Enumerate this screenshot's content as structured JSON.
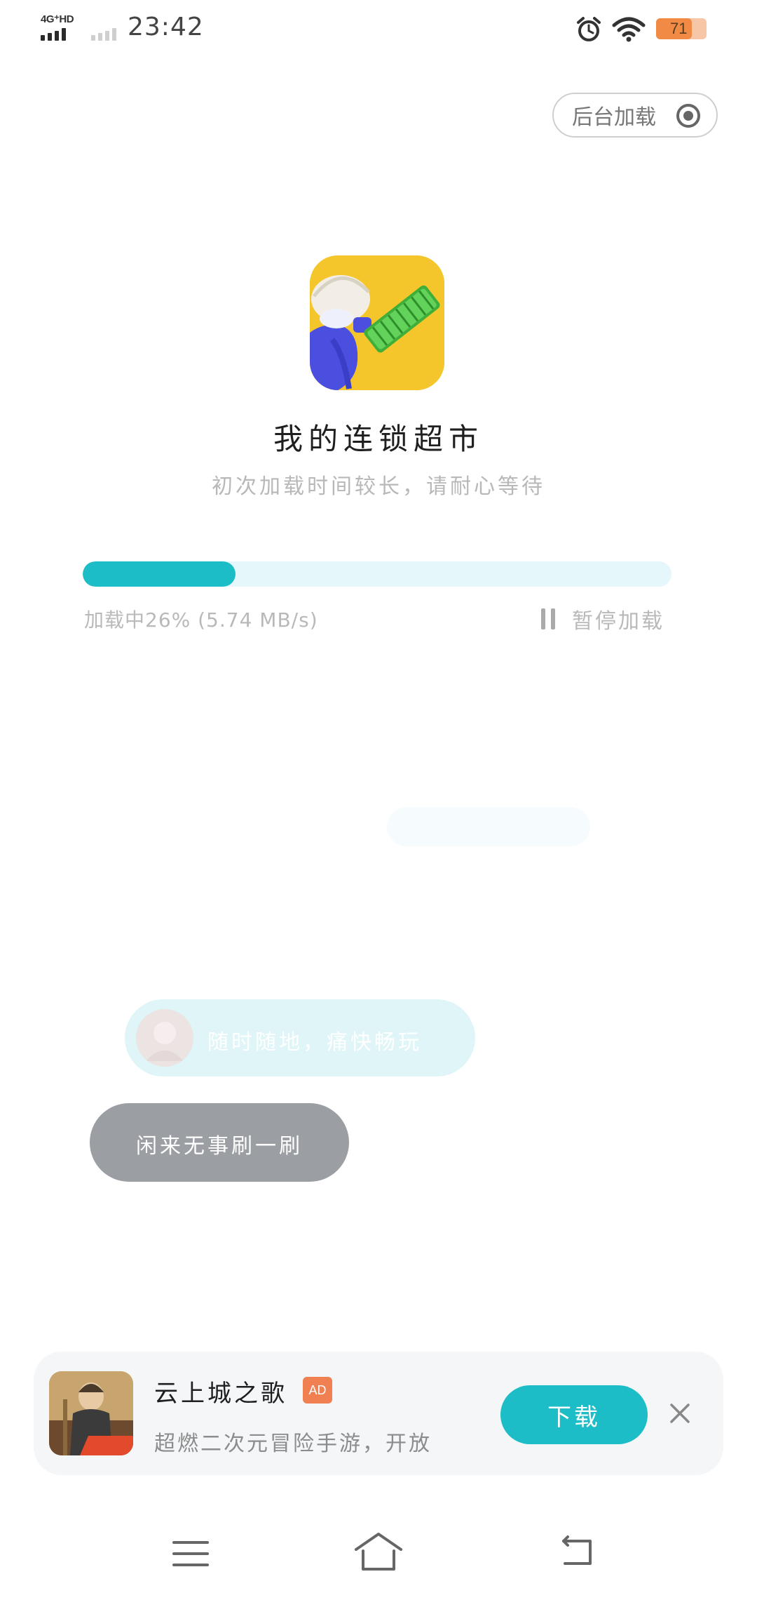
{
  "status_bar": {
    "network_label": "4G⁺HD",
    "time": "23:42",
    "battery_level": "71",
    "icons": [
      "alarm-icon",
      "wifi-icon",
      "battery-icon"
    ]
  },
  "header": {
    "background_load_label": "后台加载"
  },
  "app": {
    "icon": "app-icon",
    "title": "我的连锁超市",
    "subtitle": "初次加载时间较长，请耐心等待"
  },
  "progress": {
    "percent": 26,
    "status_text": "加载中26% (5.74 MB/s)",
    "pause_label": "暂停加载",
    "accent_color": "#1cbdc6",
    "track_color": "#e6f7fb"
  },
  "bubbles": {
    "first_text": "随时随地，痛快畅玩",
    "second_text": "闲来无事刷一刷"
  },
  "ad": {
    "title": "云上城之歌",
    "badge": "AD",
    "description": "超燃二次元冒险手游，开放",
    "download_label": "下载",
    "close_icon": "close-icon"
  },
  "navigation": {
    "icons": [
      "menu-icon",
      "home-icon",
      "back-icon"
    ]
  }
}
